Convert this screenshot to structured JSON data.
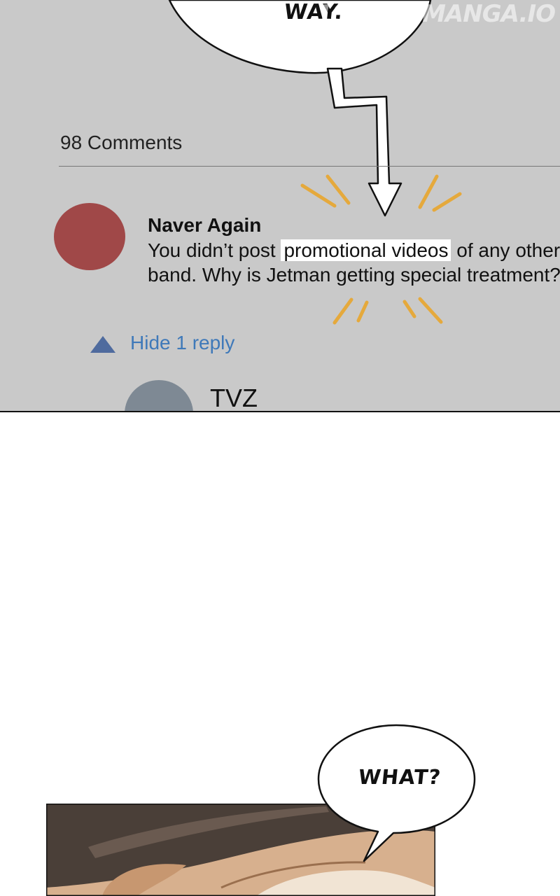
{
  "top_bubble": {
    "text": "WAY."
  },
  "watermark": "1STKISSMANGA.IO",
  "comments": {
    "count_label": "98 Comments",
    "items": [
      {
        "author": "Naver Again",
        "text_before": "You didn’t post ",
        "text_highlight": "promotional videos",
        "text_after": " of any other band. Why is Jetman getting special treatment?",
        "avatar_color": "#a04848"
      }
    ],
    "reply_toggle_label": "Hide 1 reply",
    "reply_author": "TVZ",
    "reply_avatar_color": "#7e8994"
  },
  "bottom_bubble": {
    "text": "WHAT?"
  },
  "colors": {
    "panel_bg": "#c9c9c9",
    "link": "#3f79b9",
    "reply_icon": "#4f6b9e",
    "emphasis_marks": "#e5a93c"
  }
}
